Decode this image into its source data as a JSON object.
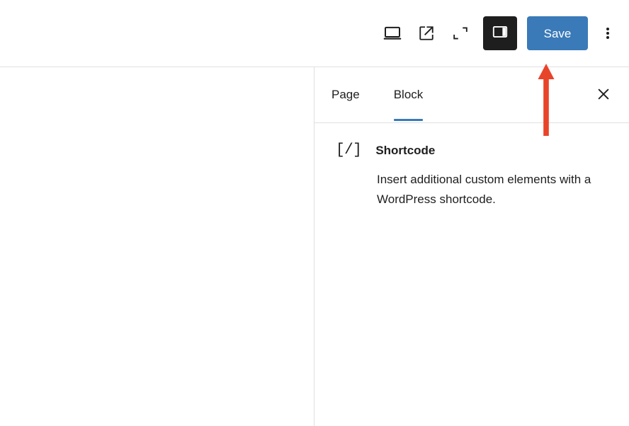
{
  "toolbar": {
    "device_preview_icon": "laptop-icon",
    "view_site_icon": "external-link-icon",
    "zen_mode_icon": "fullscreen-corners-icon",
    "settings_toggle_icon": "sidebar-panel-icon",
    "save_label": "Save",
    "more_options_icon": "three-vertical-dots-icon"
  },
  "sidebar": {
    "tabs": [
      {
        "label": "Page",
        "active": false
      },
      {
        "label": "Block",
        "active": true
      }
    ],
    "close_icon": "close-x-icon",
    "block": {
      "icon_glyph": "[/]",
      "icon_name": "shortcode-icon",
      "title": "Shortcode",
      "description": "Insert additional custom elements with a WordPress shortcode."
    }
  },
  "annotation": {
    "arrow_name": "red-up-arrow",
    "color": "#e8442a",
    "points_to": "Save"
  },
  "colors": {
    "accent_blue": "#3a7ab8",
    "dark_button": "#1e1e1e",
    "border": "#e0e0e0",
    "text": "#1e1e1e",
    "annotation_red": "#e8442a"
  }
}
